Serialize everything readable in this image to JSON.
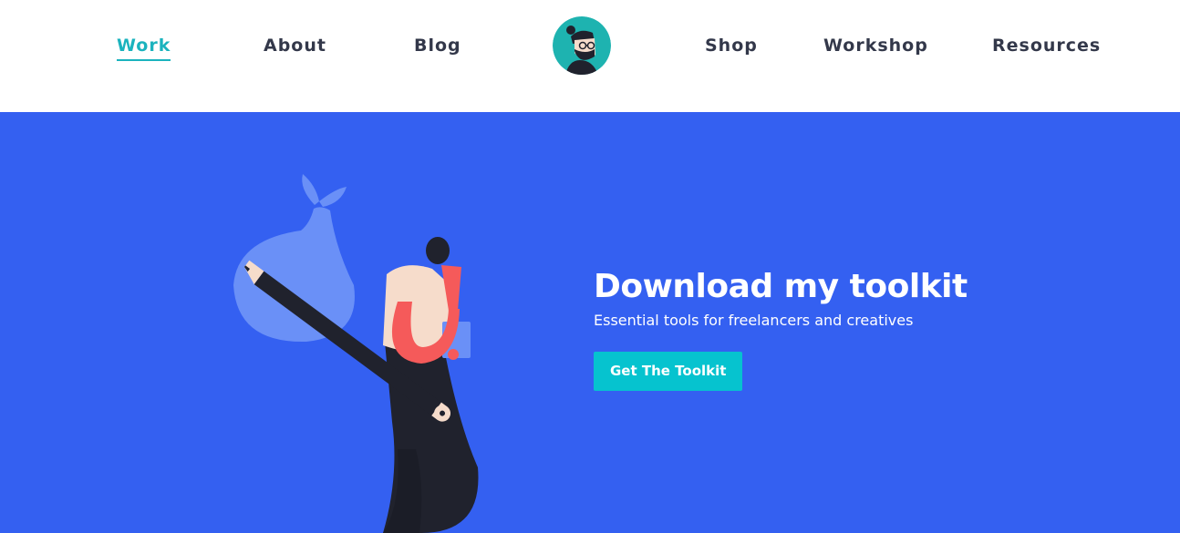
{
  "colors": {
    "accent": "#1bb3be",
    "nav_text": "#33384a",
    "hero_background": "#3460f1",
    "button_background": "#06c3cf",
    "bag": "#6a90f7",
    "pencil": "#20222d",
    "arm": "#f55a5a"
  },
  "nav": {
    "items": [
      {
        "label": "Work",
        "active": true
      },
      {
        "label": "About"
      },
      {
        "label": "Blog"
      },
      {
        "label": "Shop"
      },
      {
        "label": "Workshop"
      },
      {
        "label": "Resources"
      }
    ],
    "logo_icon": "avatar-logo-icon"
  },
  "hero": {
    "title": "Download my toolkit",
    "subtitle": "Essential tools for freelancers and creatives",
    "button_label": "Get The Toolkit",
    "illustration": "person-carrying-pencil-bindle-illustration"
  }
}
